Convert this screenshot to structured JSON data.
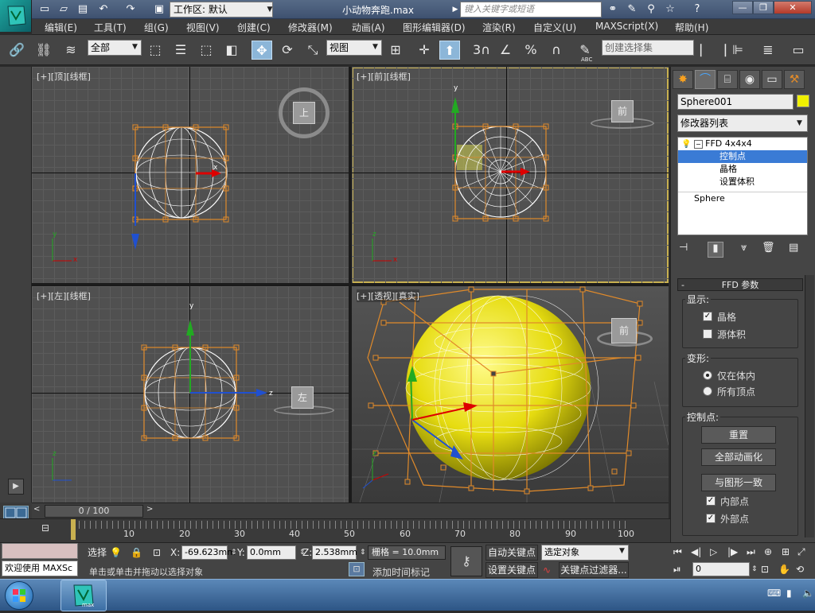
{
  "titlebar": {
    "workspace_label": "工作区: 默认",
    "document_title": "小动物奔跑.max",
    "search_placeholder": "键入关键字或短语",
    "app_icon_text": "max"
  },
  "menu": [
    "编辑(E)",
    "工具(T)",
    "组(G)",
    "视图(V)",
    "创建(C)",
    "修改器(M)",
    "动画(A)",
    "图形编辑器(D)",
    "渲染(R)",
    "自定义(U)",
    "MAXScript(X)",
    "帮助(H)"
  ],
  "toolbar": {
    "selection_filter": "全部",
    "reference_coord": "视图",
    "named_selection_placeholder": "创建选择集",
    "snap_3": "3",
    "abc_label": "ABC"
  },
  "viewports": [
    {
      "label": "[+][顶][线框]",
      "view_cube_label": "上"
    },
    {
      "label": "[+][前][线框]",
      "view_cube_label": "前"
    },
    {
      "label": "[+][左][线框]",
      "view_cube_label": "左"
    },
    {
      "label": "[+][透视][真实]",
      "view_cube_label": "前"
    }
  ],
  "axis_labels": {
    "x": "x",
    "y": "y",
    "z": "z"
  },
  "command_panel": {
    "object_name": "Sphere001",
    "object_color": "#f0f000",
    "modifier_list": "修改器列表",
    "stack": [
      {
        "label": "FFD 4x4x4",
        "level": 0,
        "selected": false
      },
      {
        "label": "控制点",
        "level": 1,
        "selected": true
      },
      {
        "label": "晶格",
        "level": 1,
        "selected": false
      },
      {
        "label": "设置体积",
        "level": 1,
        "selected": false
      },
      {
        "label": "Sphere",
        "level": 0,
        "selected": false
      }
    ],
    "rollout_title": "FFD 参数",
    "rollout_toggle": "-",
    "display_group": "显示:",
    "display_lattice": "晶格",
    "display_source_volume": "源体积",
    "deform_group": "变形:",
    "deform_only_in_volume": "仅在体内",
    "deform_all_vertices": "所有顶点",
    "control_points_group": "控制点:",
    "btn_reset": "重置",
    "btn_animate_all": "全部动画化",
    "btn_conform": "与图形一致",
    "inside_points": "内部点",
    "outside_points": "外部点"
  },
  "timeline": {
    "frame_display": "0 / 100",
    "ticks": [
      "10",
      "20",
      "30",
      "40",
      "50",
      "60",
      "70",
      "80",
      "90",
      "100"
    ],
    "current_frame": 0,
    "total_frames": 100
  },
  "status": {
    "welcome": "欢迎使用 MAXSc",
    "selected_label": "选择",
    "x_label": "X:",
    "x_value": "-69.623mm",
    "y_label": "Y:",
    "y_value": "0.0mm",
    "z_label": "Z:",
    "z_value": "2.538mm",
    "grid_value": "栅格 = 10.0mm",
    "prompt": "单击或单击并拖动以选择对象",
    "add_time_tag": "添加时间标记",
    "auto_key": "自动关键点",
    "set_key": "设置关键点",
    "selected_object": "选定对象",
    "key_filters": "关键点过滤器...",
    "frame_field": "0"
  }
}
